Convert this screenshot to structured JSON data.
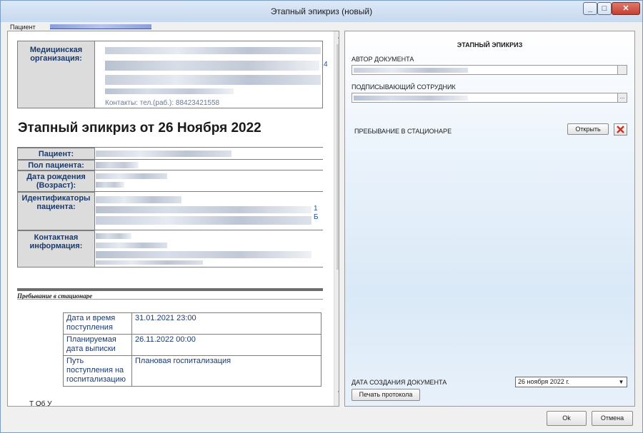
{
  "window": {
    "title": "Этапный эпикриз (новый)",
    "min_glyph": "_",
    "max_glyph": "□",
    "close_glyph": "✕"
  },
  "patient_label": "Пациент",
  "document": {
    "org_label": "Медицинская организация:",
    "contacts_partial": "Контакты: тел.(раб.): 88423421558",
    "edge_digit_4": "4",
    "heading": "Этапный эпикриз от 26 Ноября 2022",
    "patient_rows": [
      {
        "label": "Пациент:"
      },
      {
        "label": "Пол пациента:"
      },
      {
        "label": "Дата рождения (Возраст):"
      },
      {
        "label": "Идентификаторы пациента:"
      },
      {
        "label": "Контактная информация:"
      }
    ],
    "edge_digit_1": "1",
    "edge_letter_b": "Б",
    "section_title": "Пребывание в стационаре",
    "stay_rows": [
      {
        "key": "Дата и время поступления",
        "value": "31.01.2021 23:00"
      },
      {
        "key": "Планируемая дата выписки",
        "value": "26.11.2022 00:00"
      },
      {
        "key": "Путь поступления на госпитализацию",
        "value": "Плановая госпитализация"
      }
    ],
    "cut_row_text": "Т         Об         У"
  },
  "form": {
    "title": "ЭТАПНЫЙ ЭПИКРИЗ",
    "author_label": "АВТОР ДОКУМЕНТА",
    "signer_label": "ПОДПИСЫВАЮЩИЙ СОТРУДНИК",
    "lookup_glyph": "...",
    "stay_label": "ПРЕБЫВАНИЕ В СТАЦИОНАРЕ",
    "open_button": "Открыть",
    "creation_date_label": "ДАТА СОЗДАНИЯ ДОКУМЕНТА",
    "creation_date_value": "26  ноября  2022 г.",
    "print_button": "Печать протокола"
  },
  "footer": {
    "ok": "Ok",
    "cancel": "Отмена"
  }
}
